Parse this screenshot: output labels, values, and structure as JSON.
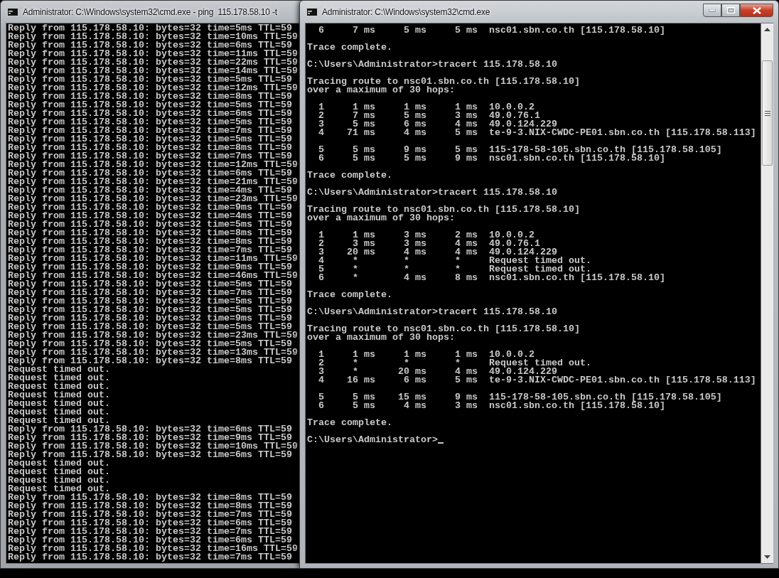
{
  "background_window": {
    "title": "Administrator: C:\\Windows\\system32\\cmd.exe - ping  115.178.58.10 -t",
    "lines": [
      "Reply from 115.178.58.10: bytes=32 time=5ms TTL=59",
      "Reply from 115.178.58.10: bytes=32 time=10ms TTL=59",
      "Reply from 115.178.58.10: bytes=32 time=6ms TTL=59",
      "Reply from 115.178.58.10: bytes=32 time=11ms TTL=59",
      "Reply from 115.178.58.10: bytes=32 time=22ms TTL=59",
      "Reply from 115.178.58.10: bytes=32 time=14ms TTL=59",
      "Reply from 115.178.58.10: bytes=32 time=5ms TTL=59",
      "Reply from 115.178.58.10: bytes=32 time=12ms TTL=59",
      "Reply from 115.178.58.10: bytes=32 time=8ms TTL=59",
      "Reply from 115.178.58.10: bytes=32 time=5ms TTL=59",
      "Reply from 115.178.58.10: bytes=32 time=6ms TTL=59",
      "Reply from 115.178.58.10: bytes=32 time=5ms TTL=59",
      "Reply from 115.178.58.10: bytes=32 time=7ms TTL=59",
      "Reply from 115.178.58.10: bytes=32 time=5ms TTL=59",
      "Reply from 115.178.58.10: bytes=32 time=8ms TTL=59",
      "Reply from 115.178.58.10: bytes=32 time=7ms TTL=59",
      "Reply from 115.178.58.10: bytes=32 time=12ms TTL=59",
      "Reply from 115.178.58.10: bytes=32 time=6ms TTL=59",
      "Reply from 115.178.58.10: bytes=32 time=21ms TTL=59",
      "Reply from 115.178.58.10: bytes=32 time=4ms TTL=59",
      "Reply from 115.178.58.10: bytes=32 time=23ms TTL=59",
      "Reply from 115.178.58.10: bytes=32 time=9ms TTL=59",
      "Reply from 115.178.58.10: bytes=32 time=4ms TTL=59",
      "Reply from 115.178.58.10: bytes=32 time=5ms TTL=59",
      "Reply from 115.178.58.10: bytes=32 time=8ms TTL=59",
      "Reply from 115.178.58.10: bytes=32 time=8ms TTL=59",
      "Reply from 115.178.58.10: bytes=32 time=7ms TTL=59",
      "Reply from 115.178.58.10: bytes=32 time=11ms TTL=59",
      "Reply from 115.178.58.10: bytes=32 time=9ms TTL=59",
      "Reply from 115.178.58.10: bytes=32 time=46ms TTL=59",
      "Reply from 115.178.58.10: bytes=32 time=5ms TTL=59",
      "Reply from 115.178.58.10: bytes=32 time=7ms TTL=59",
      "Reply from 115.178.58.10: bytes=32 time=5ms TTL=59",
      "Reply from 115.178.58.10: bytes=32 time=5ms TTL=59",
      "Reply from 115.178.58.10: bytes=32 time=9ms TTL=59",
      "Reply from 115.178.58.10: bytes=32 time=5ms TTL=59",
      "Reply from 115.178.58.10: bytes=32 time=23ms TTL=59",
      "Reply from 115.178.58.10: bytes=32 time=5ms TTL=59",
      "Reply from 115.178.58.10: bytes=32 time=13ms TTL=59",
      "Reply from 115.178.58.10: bytes=32 time=8ms TTL=59",
      "Request timed out.",
      "Request timed out.",
      "Request timed out.",
      "Request timed out.",
      "Request timed out.",
      "Request timed out.",
      "Request timed out.",
      "Reply from 115.178.58.10: bytes=32 time=6ms TTL=59",
      "Reply from 115.178.58.10: bytes=32 time=9ms TTL=59",
      "Reply from 115.178.58.10: bytes=32 time=10ms TTL=59",
      "Reply from 115.178.58.10: bytes=32 time=6ms TTL=59",
      "Request timed out.",
      "Request timed out.",
      "Request timed out.",
      "Request timed out.",
      "Reply from 115.178.58.10: bytes=32 time=8ms TTL=59",
      "Reply from 115.178.58.10: bytes=32 time=8ms TTL=59",
      "Reply from 115.178.58.10: bytes=32 time=7ms TTL=59",
      "Reply from 115.178.58.10: bytes=32 time=6ms TTL=59",
      "Reply from 115.178.58.10: bytes=32 time=7ms TTL=59",
      "Reply from 115.178.58.10: bytes=32 time=6ms TTL=59",
      "Reply from 115.178.58.10: bytes=32 time=16ms TTL=59",
      "Reply from 115.178.58.10: bytes=32 time=7ms TTL=59"
    ]
  },
  "foreground_window": {
    "title": "Administrator: C:\\Windows\\system32\\cmd.exe",
    "paragraphs": [
      [
        "  6     7 ms     5 ms     5 ms  nsc01.sbn.co.th [115.178.58.10]"
      ],
      [
        "Trace complete."
      ],
      [
        "C:\\Users\\Administrator>tracert 115.178.58.10"
      ],
      [
        "Tracing route to nsc01.sbn.co.th [115.178.58.10]",
        "over a maximum of 30 hops:"
      ],
      [
        "  1     1 ms     1 ms     1 ms  10.0.0.2",
        "  2     7 ms     5 ms     3 ms  49.0.76.1",
        "  3     5 ms     6 ms     4 ms  49.0.124.229",
        "  4    71 ms     4 ms     5 ms  te-9-3.NIX-CWDC-PE01.sbn.co.th [115.178.58.113]"
      ],
      [
        "  5     5 ms     9 ms     5 ms  115-178-58-105.sbn.co.th [115.178.58.105]",
        "  6     5 ms     5 ms     9 ms  nsc01.sbn.co.th [115.178.58.10]"
      ],
      [
        "Trace complete."
      ],
      [
        "C:\\Users\\Administrator>tracert 115.178.58.10"
      ],
      [
        "Tracing route to nsc01.sbn.co.th [115.178.58.10]",
        "over a maximum of 30 hops:"
      ],
      [
        "  1     1 ms     3 ms     2 ms  10.0.0.2",
        "  2     3 ms     3 ms     4 ms  49.0.76.1",
        "  3    20 ms     4 ms     4 ms  49.0.124.229",
        "  4     *        *        *     Request timed out.",
        "  5     *        *        *     Request timed out.",
        "  6     *        4 ms     8 ms  nsc01.sbn.co.th [115.178.58.10]"
      ],
      [
        "Trace complete."
      ],
      [
        "C:\\Users\\Administrator>tracert 115.178.58.10"
      ],
      [
        "Tracing route to nsc01.sbn.co.th [115.178.58.10]",
        "over a maximum of 30 hops:"
      ],
      [
        "  1     1 ms     1 ms     1 ms  10.0.0.2",
        "  2     *        *        *     Request timed out.",
        "  3     *       20 ms     4 ms  49.0.124.229",
        "  4    16 ms     6 ms     5 ms  te-9-3.NIX-CWDC-PE01.sbn.co.th [115.178.58.113]"
      ],
      [
        "  5     5 ms    15 ms     9 ms  115-178-58-105.sbn.co.th [115.178.58.105]",
        "  6     5 ms     4 ms     3 ms  nsc01.sbn.co.th [115.178.58.10]"
      ],
      [
        "Trace complete."
      ]
    ],
    "prompt": {
      "text": "C:\\Users\\Administrator>",
      "cursor": true
    }
  }
}
